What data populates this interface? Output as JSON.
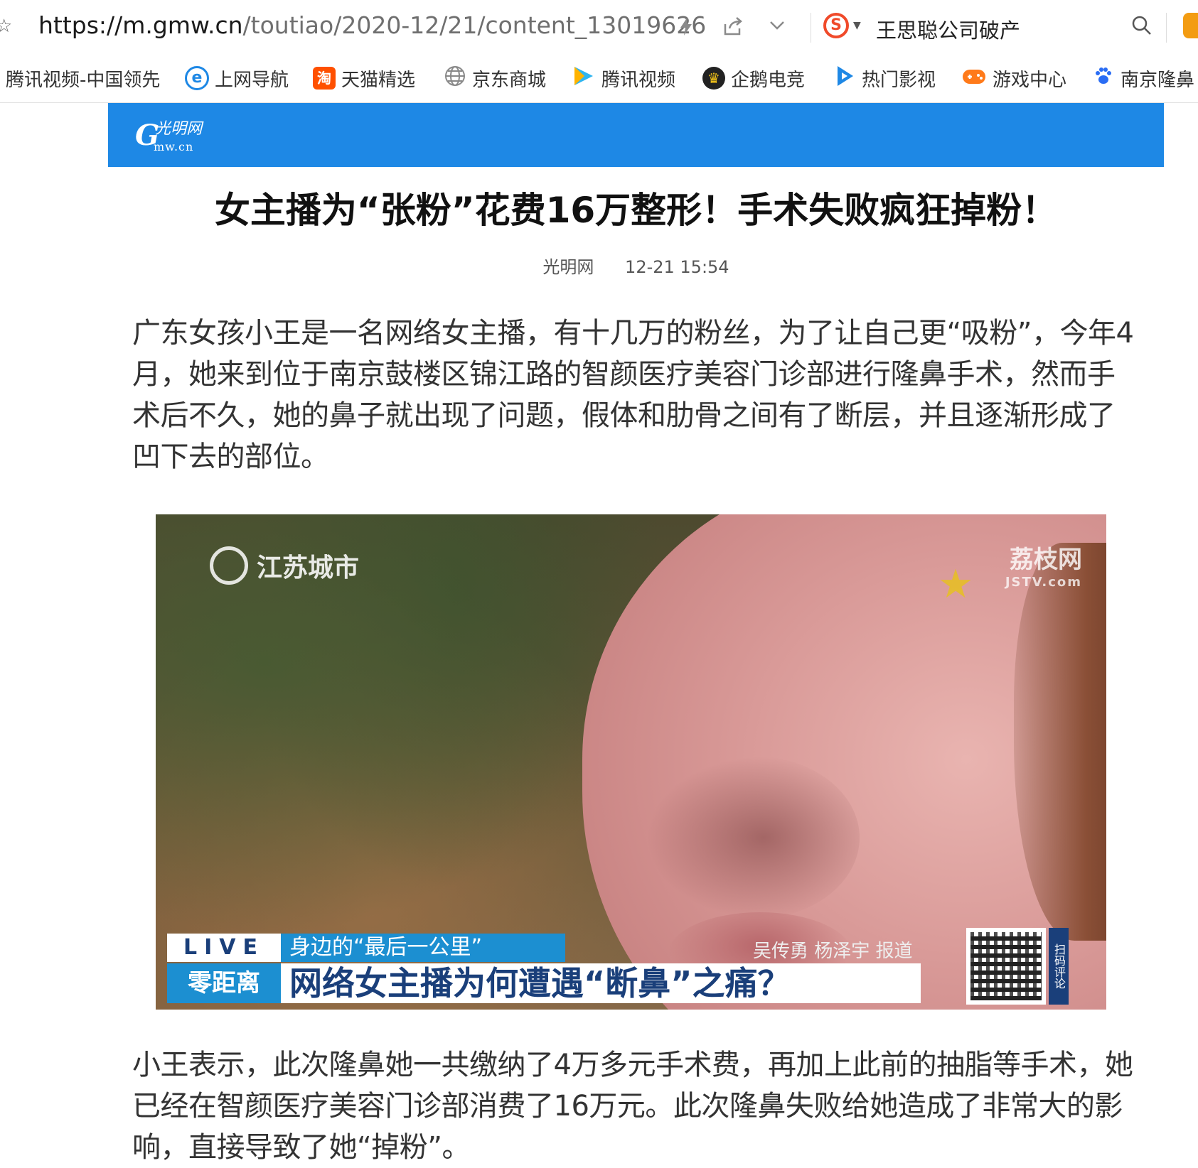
{
  "browser": {
    "url_main": "https://m.gmw.cn",
    "url_path": "/toutiao/2020-12/21/content_13019626",
    "search_query": "王思聪公司破产",
    "search_engine_icon": "sogou-icon"
  },
  "bookmarks": [
    {
      "label": "腾讯视频-中国领先",
      "icon": "",
      "color": "#ffffff"
    },
    {
      "label": "上网导航",
      "icon": "e",
      "color": "#1e88e5"
    },
    {
      "label": "天猫精选",
      "icon": "淘",
      "color": "#ff5000"
    },
    {
      "label": "京东商城",
      "icon": "globe-icon",
      "color": "#888888"
    },
    {
      "label": "腾讯视频",
      "icon": "play-icon",
      "color": "#2fb5f0"
    },
    {
      "label": "企鹅电竞",
      "icon": "penguin-icon",
      "color": "#222222"
    },
    {
      "label": "热门影视",
      "icon": "play-icon",
      "color": "#1e88e5"
    },
    {
      "label": "游戏中心",
      "icon": "gamepad-icon",
      "color": "#ff7a1a"
    },
    {
      "label": "南京隆鼻",
      "icon": "paw-icon",
      "color": "#2a6df4"
    }
  ],
  "site": {
    "logo_mark": "G",
    "logo_cn": "光明网",
    "logo_domain": "mw.cn",
    "header_color": "#1e88e5"
  },
  "article": {
    "title": "女主播为“张粉”花费16万整形！手术失败疯狂掉粉！",
    "source": "光明网",
    "time": "12-21 15:54",
    "paragraph1": "广东女孩小王是一名网络女主播，有十几万的粉丝，为了让自己更“吸粉”，今年4月，她来到位于南京鼓楼区锦江路的智颜医疗美容门诊部进行隆鼻手术，然而手术后不久，她的鼻子就出现了问题，假体和肋骨之间有了断层，并且逐渐形成了凹下去的部位。",
    "paragraph2": "小王表示，此次隆鼻她一共缴纳了4万多元手术费，再加上此前的抽脂等手术，她已经在智颜医疗美容门诊部消费了16万元。此次隆鼻失败给她造成了非常大的影响，直接导致了她“掉粉”。"
  },
  "video_frame": {
    "watermark_left": "江苏城市",
    "watermark_right": "荔枝网",
    "watermark_right_sub": "JSTV.com",
    "live_label": "LIVE",
    "segment_tag": "身边的“最后一公里”",
    "reporter": "吴传勇 杨泽宇 报道",
    "program_brand": "零距离",
    "headline": "网络女主播为何遭遇“断鼻”之痛？",
    "qr_label": "扫码评论"
  }
}
